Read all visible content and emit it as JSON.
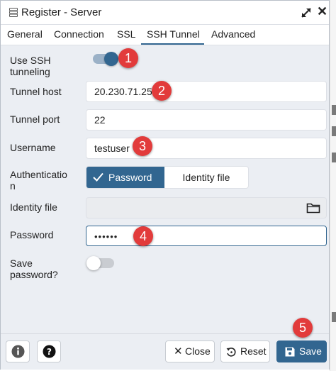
{
  "window": {
    "title": "Register - Server"
  },
  "tabs": [
    {
      "label": "General"
    },
    {
      "label": "Connection"
    },
    {
      "label": "SSL"
    },
    {
      "label": "SSH Tunnel"
    },
    {
      "label": "Advanced"
    }
  ],
  "active_tab": "SSH Tunnel",
  "form": {
    "use_ssh": {
      "label_line1": "Use SSH",
      "label_line2": "tunneling",
      "value": true
    },
    "tunnel_host": {
      "label": "Tunnel host",
      "value": "20.230.71.25"
    },
    "tunnel_port": {
      "label": "Tunnel port",
      "value": "22"
    },
    "username": {
      "label": "Username",
      "value": "testuser"
    },
    "authentication": {
      "label_line1": "Authenticatio",
      "label_line2": "n",
      "options": [
        "Password",
        "Identity file"
      ],
      "selected": "Password"
    },
    "identity_file": {
      "label": "Identity file",
      "value": ""
    },
    "password": {
      "label": "Password",
      "value": "••••••"
    },
    "save_password": {
      "label_line1": "Save",
      "label_line2": "password?",
      "value": false
    }
  },
  "footer": {
    "close_label": "Close",
    "reset_label": "Reset",
    "save_label": "Save"
  },
  "annotations": [
    "1",
    "2",
    "3",
    "4",
    "5"
  ],
  "colors": {
    "accent": "#326690",
    "badge": "#e23b3b",
    "dialog_bg": "#ebeef3"
  },
  "icons": {
    "title": "server-icon",
    "expand": "expand-icon",
    "close": "close-icon",
    "check": "check-icon",
    "folder": "folder-icon",
    "info": "info-icon",
    "help": "help-icon",
    "close_btn": "x-icon",
    "reset": "reset-icon",
    "save": "floppy-disk-icon"
  }
}
